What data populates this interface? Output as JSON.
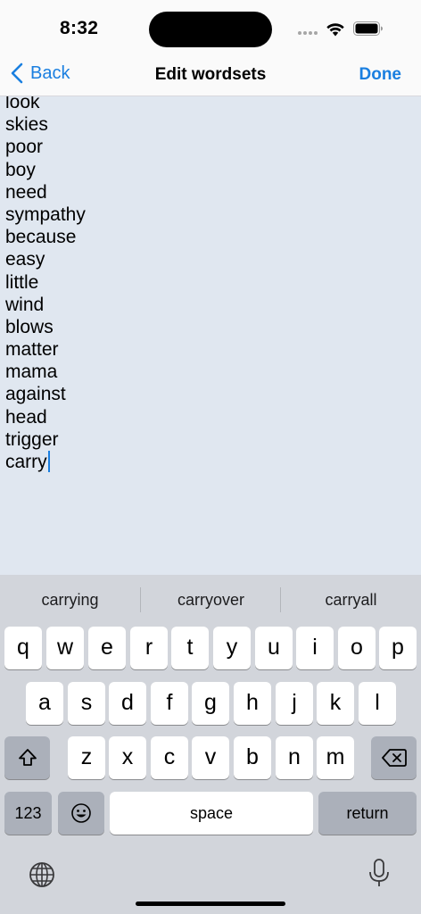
{
  "status_bar": {
    "time": "8:32"
  },
  "nav": {
    "back_label": "Back",
    "title": "Edit wordsets",
    "done_label": "Done"
  },
  "editor": {
    "words": [
      "look",
      "skies",
      "poor",
      "boy",
      "need",
      "sympathy",
      "because",
      "easy",
      "little",
      "wind",
      "blows",
      "matter",
      "mama",
      "against",
      "head",
      "trigger",
      "carry"
    ]
  },
  "keyboard": {
    "suggestions": [
      "carrying",
      "carryover",
      "carryall"
    ],
    "row1": [
      "q",
      "w",
      "e",
      "r",
      "t",
      "y",
      "u",
      "i",
      "o",
      "p"
    ],
    "row2": [
      "a",
      "s",
      "d",
      "f",
      "g",
      "h",
      "j",
      "k",
      "l"
    ],
    "row3": [
      "z",
      "x",
      "c",
      "v",
      "b",
      "n",
      "m"
    ],
    "numbers_label": "123",
    "space_label": "space",
    "return_label": "return",
    "icons": [
      "shift-icon",
      "backspace-icon",
      "emoji-icon",
      "globe-icon",
      "microphone-icon"
    ]
  },
  "colors": {
    "accent": "#1a7fe0",
    "editor_bg": "#e0e7f0",
    "keyboard_bg": "#d2d5db"
  }
}
